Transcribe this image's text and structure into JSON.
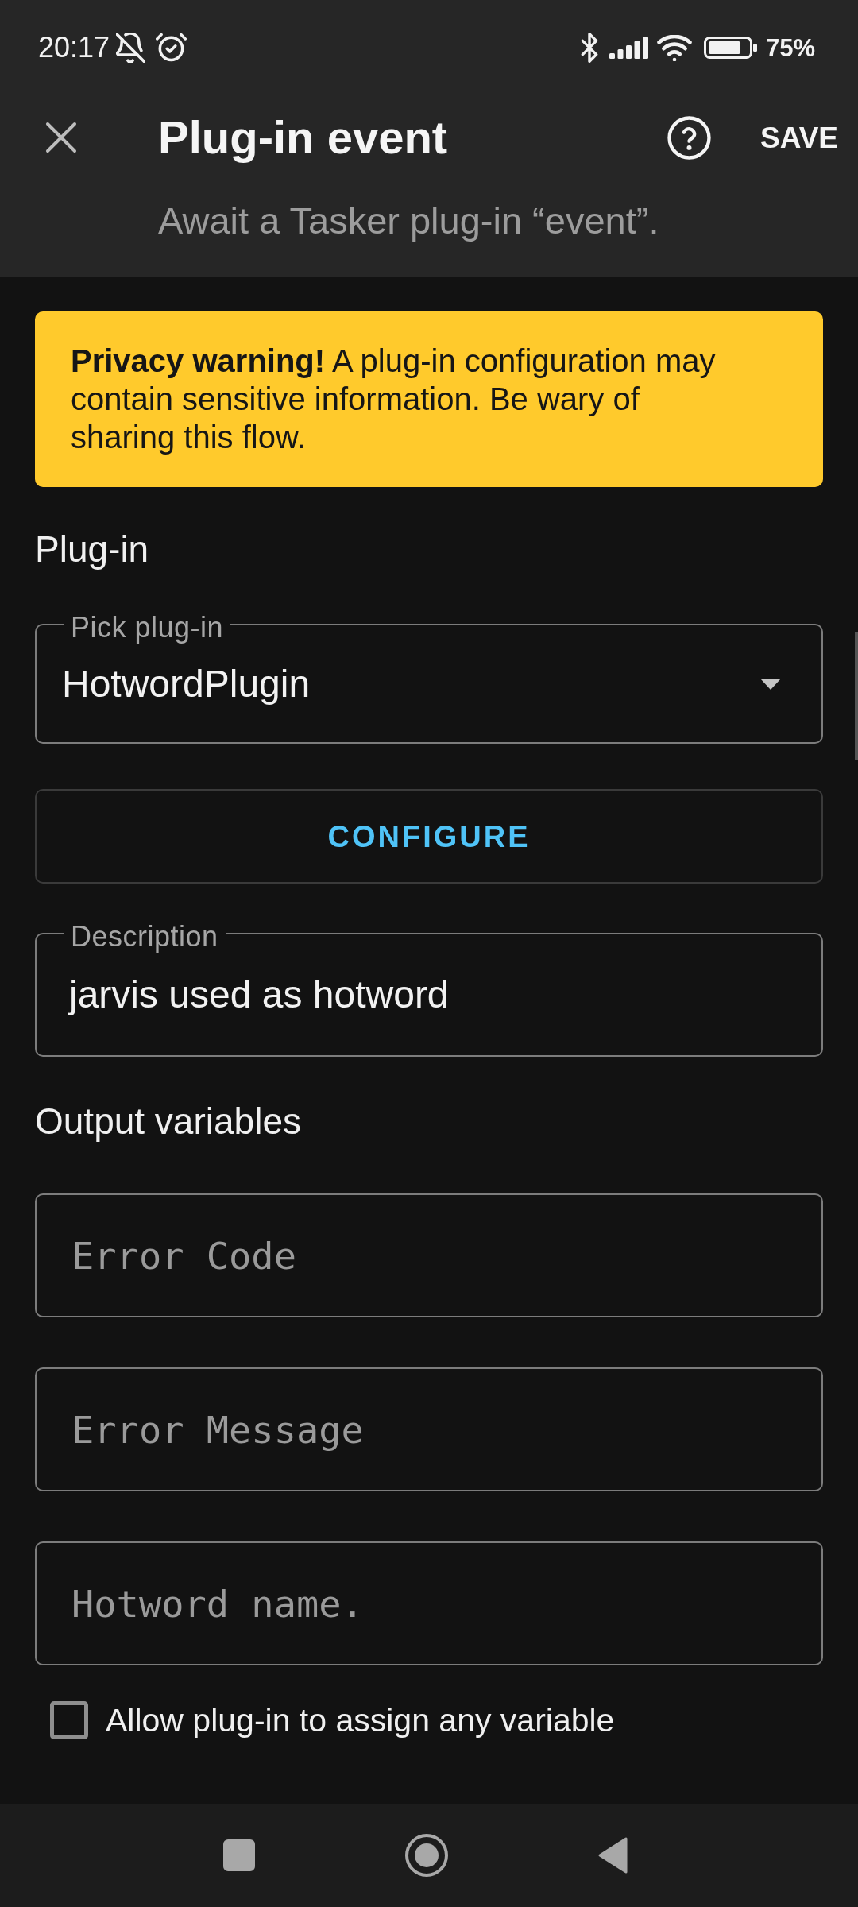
{
  "status_bar": {
    "time": "20:17",
    "battery": "75%"
  },
  "app_bar": {
    "title": "Plug-in event",
    "subtitle": "Await a Tasker plug-in “event”.",
    "save_button": "SAVE"
  },
  "warning": "**Privacy warning!** A plug-in configuration may contain sensitive information. Be wary of sharing this flow.",
  "plugin": {
    "heading": "Plug-in",
    "picker": {
      "label": "Pick plug-in",
      "value": "HotwordPlugin"
    },
    "configure_button": "CONFIGURE",
    "description": {
      "label": "Description",
      "value": "jarvis used as hotword"
    }
  },
  "output_variables": {
    "heading": "Output variables",
    "fields": [
      {
        "placeholder": "Error Code"
      },
      {
        "placeholder": "Error Message"
      },
      {
        "placeholder": "Hotword name."
      }
    ],
    "allow_any_variable": {
      "label": "Allow plug-in to assign any variable",
      "checked": false
    }
  }
}
